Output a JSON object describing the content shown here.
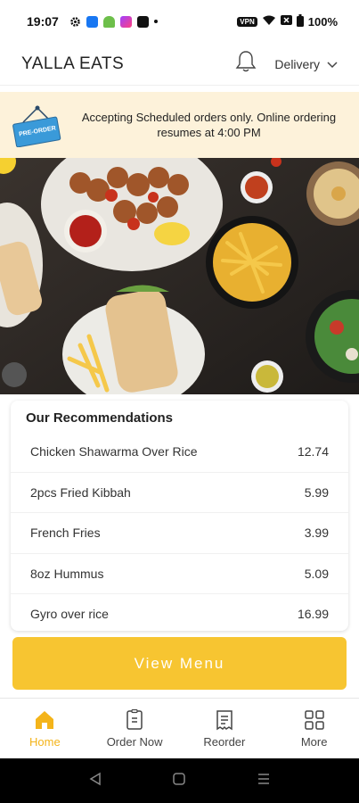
{
  "status_bar": {
    "time": "19:07",
    "vpn": "VPN",
    "battery": "100%",
    "icons": [
      "settings-icon",
      "meta-icon",
      "android-icon",
      "messenger-icon",
      "square-app-icon",
      "dot-icon"
    ]
  },
  "header": {
    "title": "YALLA EATS",
    "delivery_label": "Delivery"
  },
  "banner": {
    "sign_text": "PRE-ORDER",
    "message": "Accepting Scheduled orders only. Online ordering resumes at 4:00 PM"
  },
  "recommendations": {
    "title": "Our Recommendations",
    "items": [
      {
        "name": "Chicken Shawarma Over Rice",
        "price": "12.74"
      },
      {
        "name": "2pcs Fried Kibbah",
        "price": "5.99"
      },
      {
        "name": "French Fries",
        "price": "3.99"
      },
      {
        "name": "8oz Hummus",
        "price": "5.09"
      },
      {
        "name": "Gyro over rice",
        "price": "16.99"
      }
    ]
  },
  "view_menu_label": "View Menu",
  "bottom_nav": {
    "items": [
      {
        "label": "Home",
        "icon": "home-icon",
        "active": true
      },
      {
        "label": "Order Now",
        "icon": "order-icon",
        "active": false
      },
      {
        "label": "Reorder",
        "icon": "receipt-icon",
        "active": false
      },
      {
        "label": "More",
        "icon": "grid-icon",
        "active": false
      }
    ]
  },
  "colors": {
    "accent": "#f7c531",
    "active_nav": "#f4b41a",
    "banner_bg": "#fdf2da"
  }
}
